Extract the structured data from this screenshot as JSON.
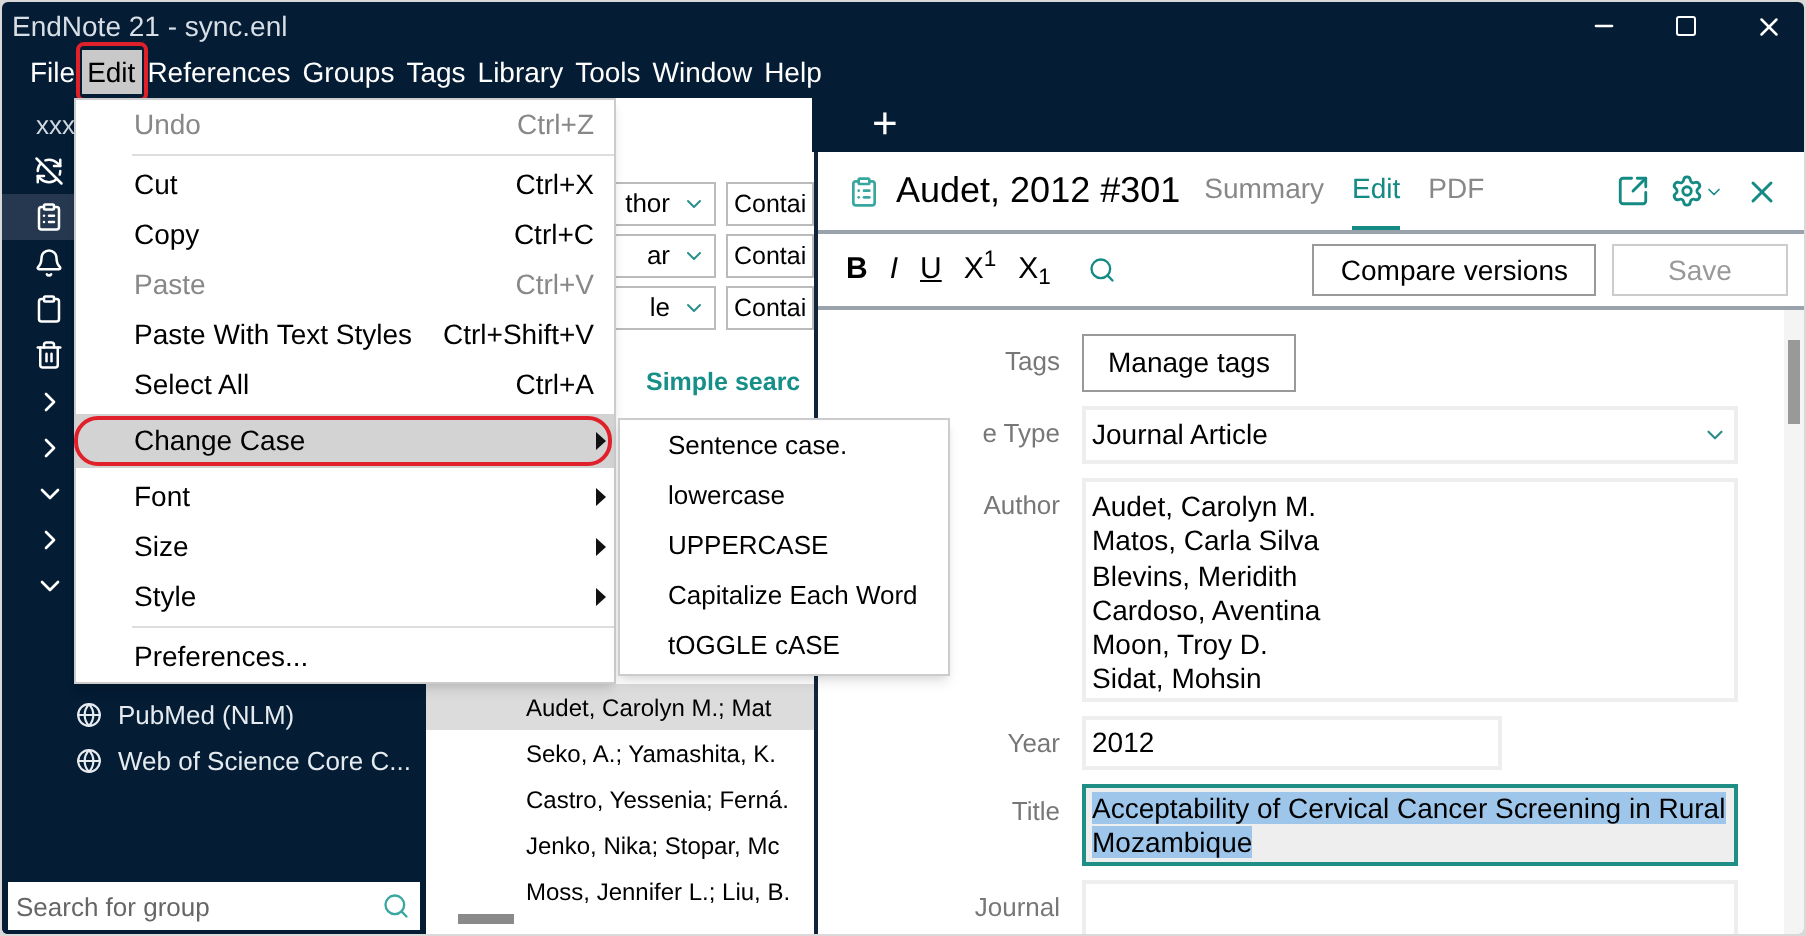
{
  "window": {
    "title": "EndNote 21 - sync.enl"
  },
  "menubar": [
    {
      "label": "File",
      "selected": false,
      "outlined": false
    },
    {
      "label": "Edit",
      "selected": true,
      "outlined": true
    },
    {
      "label": "References",
      "selected": false,
      "outlined": false
    },
    {
      "label": "Groups",
      "selected": false,
      "outlined": false
    },
    {
      "label": "Tags",
      "selected": false,
      "outlined": false
    },
    {
      "label": "Library",
      "selected": false,
      "outlined": false
    },
    {
      "label": "Tools",
      "selected": false,
      "outlined": false
    },
    {
      "label": "Window",
      "selected": false,
      "outlined": false
    },
    {
      "label": "Help",
      "selected": false,
      "outlined": false
    }
  ],
  "library_tabs": {
    "add_label": "+"
  },
  "sidebar": {
    "account": "xxx",
    "nav": [
      {
        "kind": "sync",
        "selected": false
      },
      {
        "kind": "library",
        "selected": true
      },
      {
        "kind": "bell",
        "selected": false
      },
      {
        "kind": "unfiled",
        "selected": false
      },
      {
        "kind": "trash",
        "selected": false
      }
    ],
    "group_sets": [
      {
        "expanded": false
      },
      {
        "expanded": false
      },
      {
        "expanded": true
      },
      {
        "expanded": false
      },
      {
        "expanded": true
      }
    ],
    "online": [
      {
        "label": "PubMed (NLM)"
      },
      {
        "label": "Web of Science Core C..."
      }
    ],
    "search": {
      "placeholder": "Search for group"
    }
  },
  "search_panel": {
    "rows": [
      {
        "field": "thor",
        "operator": "Contai"
      },
      {
        "field": "ar",
        "operator": "Contai"
      },
      {
        "field": "le",
        "operator": "Contai"
      }
    ],
    "mode_link": "Simple searc",
    "results": [
      {
        "author": "Audet, Carolyn M.; Mat",
        "selected": true
      },
      {
        "author": "Seko, A.; Yamashita, K.",
        "selected": false
      },
      {
        "author": "Castro, Yessenia; Ferná.",
        "selected": false
      },
      {
        "author": "Jenko, Nika; Stopar, Mc",
        "selected": false
      },
      {
        "author": "Moss, Jennifer L.; Liu, B.",
        "selected": false
      }
    ]
  },
  "reference": {
    "title": "Audet, 2012 #301",
    "tabs": [
      {
        "label": "Summary",
        "selected": false
      },
      {
        "label": "Edit",
        "selected": true
      },
      {
        "label": "PDF",
        "selected": false
      }
    ],
    "format_buttons": [
      {
        "label": "B",
        "kind": "bold"
      },
      {
        "label": "I",
        "kind": "italic"
      },
      {
        "label": "U",
        "kind": "underline"
      },
      {
        "label": "X$^{1}$",
        "kind": "plain"
      },
      {
        "label": "X$_{1}$",
        "kind": "plain"
      }
    ],
    "buttons": [
      {
        "label": "Compare versions",
        "disabled": false
      },
      {
        "label": "Save",
        "disabled": true
      }
    ],
    "fields": [
      {
        "label": "Tags",
        "kind": "button",
        "value": "Manage tags"
      },
      {
        "label": "e Type",
        "kind": "select",
        "value": "Journal Article"
      },
      {
        "label": "Author",
        "kind": "multiline",
        "lines": [
          "Audet, Carolyn M.",
          "Matos, Carla Silva",
          "Blevins, Meridith",
          "Cardoso, Aventina",
          "Moon, Troy D.",
          "Sidat, Mohsin"
        ]
      },
      {
        "label": "Year",
        "kind": "short",
        "value": "2012"
      },
      {
        "label": "Title",
        "kind": "text",
        "value": "Acceptability of Cervical Cancer Screening in Rural Mozambique",
        "focused": true,
        "text_selected": true
      },
      {
        "label": "Journal",
        "kind": "text"
      }
    ]
  },
  "edit_menu": [
    {
      "kind": "item",
      "label": "Undo",
      "shortcut": "Ctrl+Z",
      "disabled": true
    },
    {
      "kind": "separator"
    },
    {
      "kind": "item",
      "label": "Cut",
      "shortcut": "Ctrl+X",
      "disabled": false
    },
    {
      "kind": "item",
      "label": "Copy",
      "shortcut": "Ctrl+C",
      "disabled": false
    },
    {
      "kind": "item",
      "label": "Paste",
      "shortcut": "Ctrl+V",
      "disabled": true
    },
    {
      "kind": "item",
      "label": "Paste With Text Styles",
      "shortcut": "Ctrl+Shift+V",
      "disabled": false
    },
    {
      "kind": "item",
      "label": "Select All",
      "shortcut": "Ctrl+A",
      "disabled": false
    },
    {
      "kind": "submenu",
      "label": "Change Case",
      "selected": true,
      "outlined": true
    },
    {
      "kind": "submenu",
      "label": "Font",
      "selected": false,
      "outlined": false
    },
    {
      "kind": "submenu",
      "label": "Size",
      "selected": false,
      "outlined": false
    },
    {
      "kind": "submenu",
      "label": "Style",
      "selected": false,
      "outlined": false
    },
    {
      "kind": "separator"
    },
    {
      "kind": "item",
      "label": "Preferences...",
      "disabled": false
    }
  ],
  "change_case_menu": [
    "Sentence case.",
    "lowercase",
    "UPPERCASE",
    "Capitalize Each Word",
    "tOGGLE cASE"
  ]
}
